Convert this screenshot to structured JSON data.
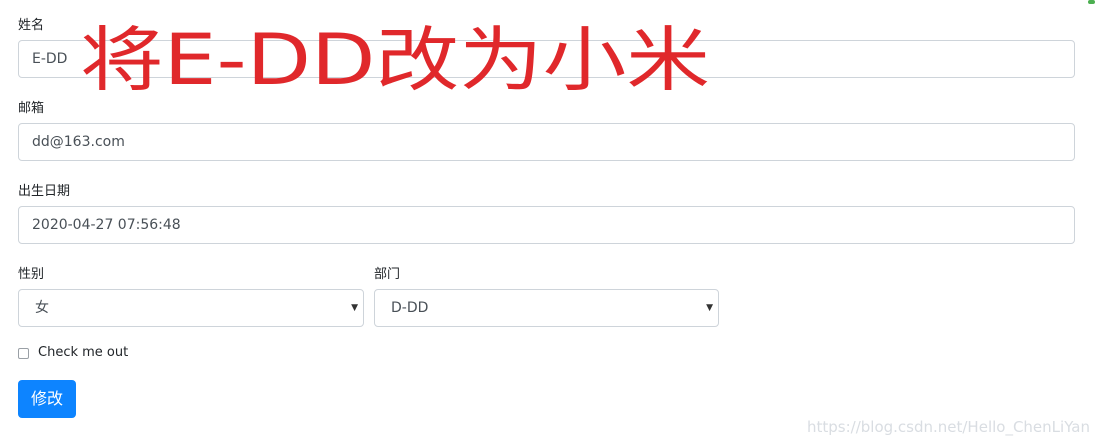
{
  "form": {
    "name_label": "姓名",
    "name_value": "E-DD",
    "email_label": "邮箱",
    "email_value": "dd@163.com",
    "birth_label": "出生日期",
    "birth_value": "2020-04-27 07:56:48",
    "gender_label": "性别",
    "gender_value": "女",
    "dept_label": "部门",
    "dept_value": "D-DD",
    "checkbox_label": "Check me out",
    "submit_label": "修改"
  },
  "annotation": {
    "text": "将E-DD改为小米",
    "color": "#e0282b"
  },
  "watermark": "https://blog.csdn.net/Hello_ChenLiYan",
  "colors": {
    "primary": "#0d84ff",
    "border": "#ced4da"
  }
}
